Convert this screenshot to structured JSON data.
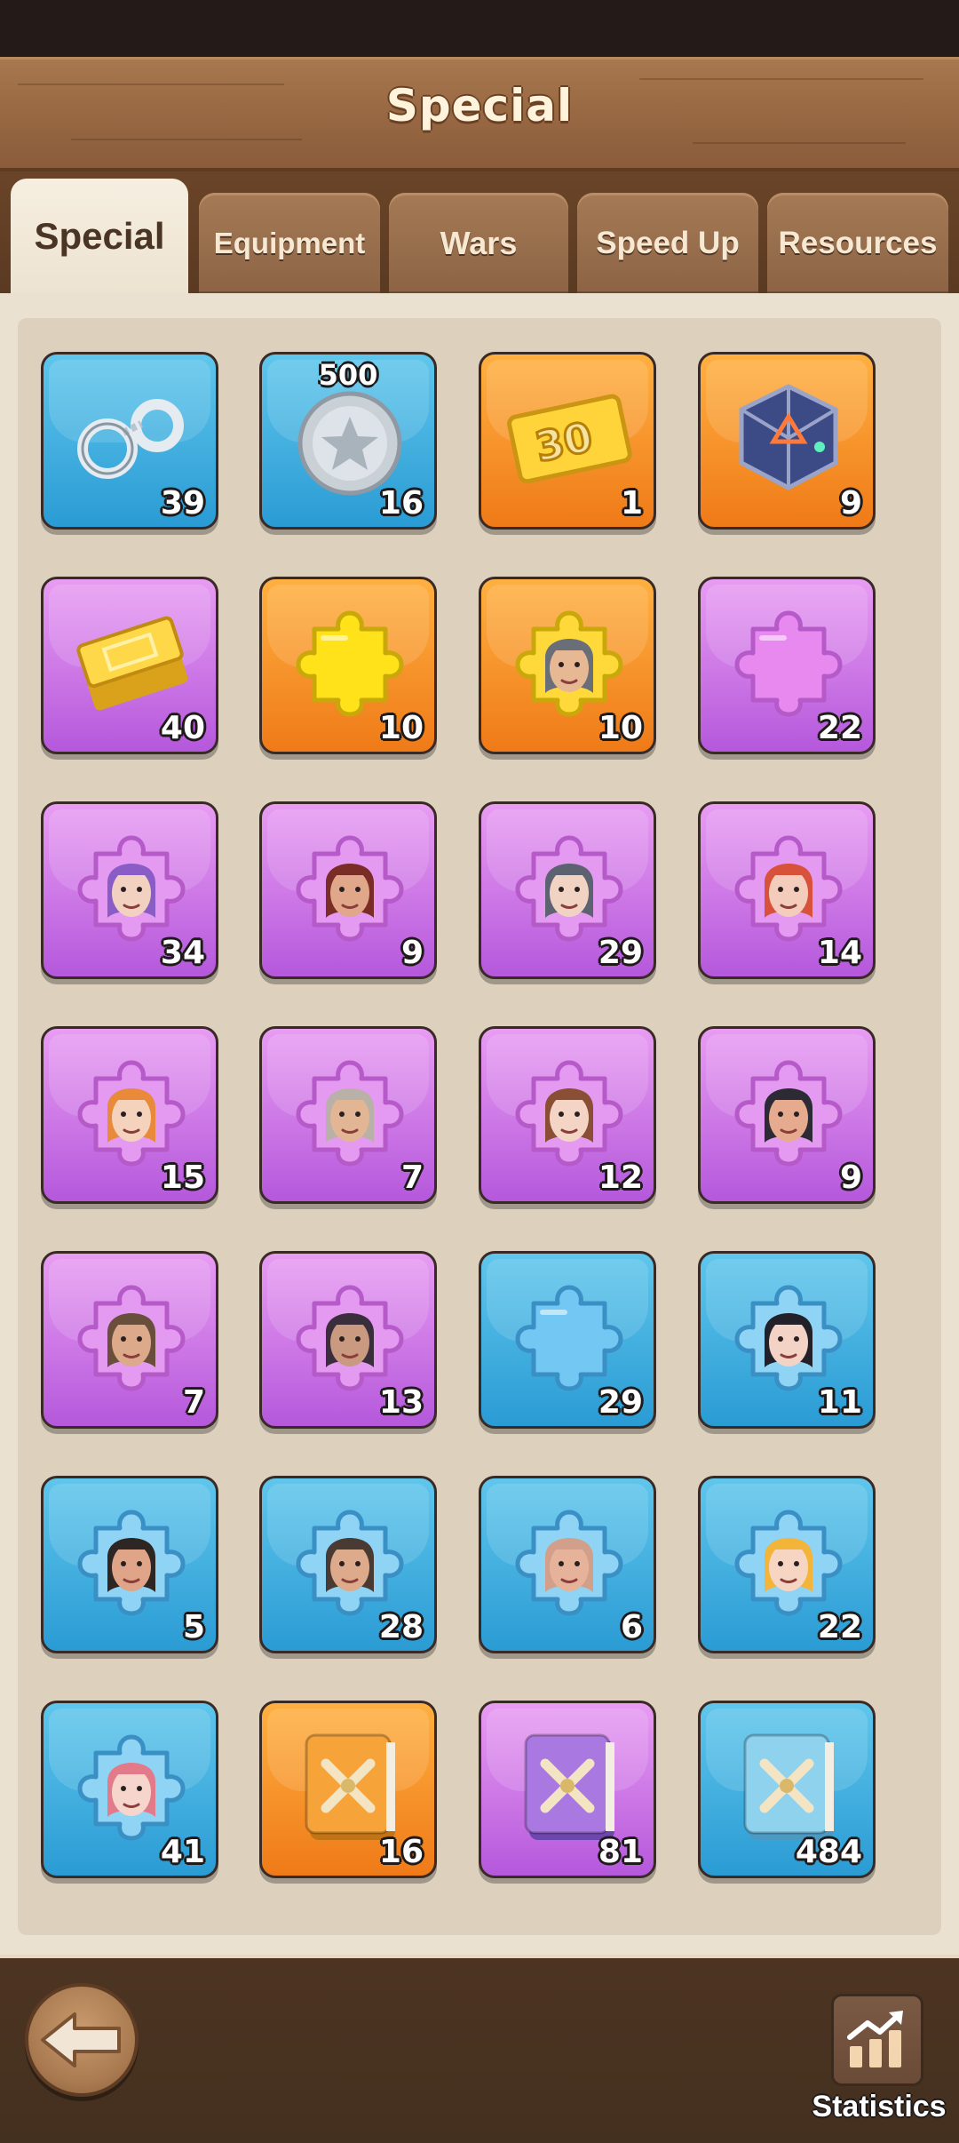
{
  "header": {
    "title": "Special"
  },
  "tabs": [
    {
      "label": "Special",
      "active": true
    },
    {
      "label": "Equipment",
      "active": false
    },
    {
      "label": "Wars",
      "active": false
    },
    {
      "label": "Speed Up",
      "active": false
    },
    {
      "label": "Resources",
      "active": false
    }
  ],
  "items": [
    {
      "icon": "handcuffs-icon",
      "color": "blue",
      "count": "39"
    },
    {
      "icon": "silver-star-coin-icon",
      "color": "blue",
      "count": "16",
      "value": "500"
    },
    {
      "icon": "gold-ticket-30-icon",
      "color": "orange",
      "count": "1",
      "ticket": "30"
    },
    {
      "icon": "mystic-cube-icon",
      "color": "orange",
      "count": "9"
    },
    {
      "icon": "gold-bars-icon",
      "color": "purple",
      "count": "40"
    },
    {
      "icon": "gold-puzzle-piece-icon",
      "color": "orange",
      "count": "10"
    },
    {
      "icon": "hero-puzzle-gray-haired-man-icon",
      "color": "orange",
      "count": "10"
    },
    {
      "icon": "purple-puzzle-piece-icon",
      "color": "purple",
      "count": "22"
    },
    {
      "icon": "hero-puzzle-purple-hair-woman-icon",
      "color": "purple",
      "count": "34"
    },
    {
      "icon": "hero-puzzle-hat-man-icon",
      "color": "purple",
      "count": "9"
    },
    {
      "icon": "hero-puzzle-gray-hair-woman-icon",
      "color": "purple",
      "count": "29"
    },
    {
      "icon": "hero-puzzle-red-hair-woman-icon",
      "color": "purple",
      "count": "14"
    },
    {
      "icon": "hero-puzzle-ginger-woman-icon",
      "color": "purple",
      "count": "15"
    },
    {
      "icon": "hero-puzzle-old-man-icon",
      "color": "purple",
      "count": "7"
    },
    {
      "icon": "hero-puzzle-brown-hair-woman-icon",
      "color": "purple",
      "count": "12"
    },
    {
      "icon": "hero-puzzle-fat-man-hat-icon",
      "color": "purple",
      "count": "9"
    },
    {
      "icon": "hero-puzzle-bearded-man-icon",
      "color": "purple",
      "count": "7"
    },
    {
      "icon": "hero-puzzle-hooded-man-icon",
      "color": "purple",
      "count": "13"
    },
    {
      "icon": "blue-puzzle-piece-icon",
      "color": "blue",
      "count": "29"
    },
    {
      "icon": "hero-puzzle-black-hair-woman-icon",
      "color": "blue",
      "count": "11"
    },
    {
      "icon": "hero-puzzle-angry-man-icon",
      "color": "blue",
      "count": "5"
    },
    {
      "icon": "hero-puzzle-bandana-man-icon",
      "color": "blue",
      "count": "28"
    },
    {
      "icon": "hero-puzzle-bald-man-icon",
      "color": "blue",
      "count": "6"
    },
    {
      "icon": "hero-puzzle-blonde-woman-icon",
      "color": "blue",
      "count": "22"
    },
    {
      "icon": "hero-puzzle-pink-hair-woman-icon",
      "color": "blue",
      "count": "41"
    },
    {
      "icon": "orange-skill-book-icon",
      "color": "orange",
      "count": "16"
    },
    {
      "icon": "purple-skill-book-icon",
      "color": "purple",
      "count": "81"
    },
    {
      "icon": "blue-skill-book-icon",
      "color": "blue",
      "count": "484"
    }
  ],
  "footer": {
    "back_icon": "back-arrow-icon",
    "statistics_icon": "statistics-chart-icon",
    "statistics_label": "Statistics"
  }
}
